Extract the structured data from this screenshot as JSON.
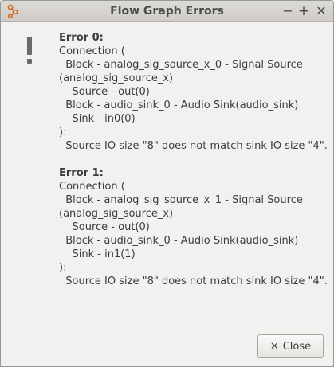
{
  "window": {
    "title": "Flow Graph Errors",
    "controls": {
      "minimize": "−",
      "maximize": "+",
      "close": "✕"
    }
  },
  "errors": [
    {
      "title": "Error 0:",
      "lines": [
        "Connection (",
        "  Block - analog_sig_source_x_0 - Signal Source",
        "(analog_sig_source_x)",
        "    Source - out(0)",
        "  Block - audio_sink_0 - Audio Sink(audio_sink)",
        "    Sink - in0(0)",
        "):",
        "  Source IO size \"8\" does not match sink IO size \"4\"."
      ]
    },
    {
      "title": "Error 1:",
      "lines": [
        "Connection (",
        "  Block - analog_sig_source_x_1 - Signal Source",
        "(analog_sig_source_x)",
        "    Source - out(0)",
        "  Block - audio_sink_0 - Audio Sink(audio_sink)",
        "    Sink - in1(1)",
        "):",
        "  Source IO size \"8\" does not match sink IO size \"4\"."
      ]
    }
  ],
  "footer": {
    "close_label": "Close"
  },
  "icons": {
    "app": "gnuradio-flowgraph-icon",
    "warning": "warning-icon",
    "close": "close-icon"
  },
  "colors": {
    "titlebar": "#d6d4cf",
    "text": "#3c3c3c",
    "background": "#f2f1f0"
  }
}
